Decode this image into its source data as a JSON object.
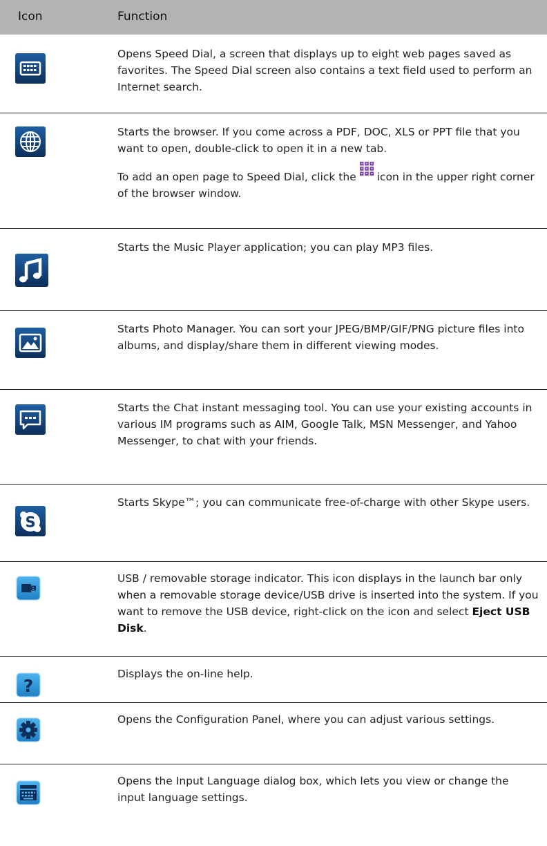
{
  "header": {
    "icon_label": "Icon",
    "function_label": "Function"
  },
  "rows": [
    {
      "icon": "speed-dial-icon",
      "text": "Opens Speed Dial, a screen that displays up to eight web pages saved as favorites. The Speed Dial screen also contains a text field used to perform an Internet search."
    },
    {
      "icon": "browser-globe-icon",
      "text": "Starts the browser. If you come across a PDF, DOC, XLS or PPT file that you want to open, double-click to open it in a new tab.",
      "text2_before": "To add an open page to Speed Dial, click the",
      "text2_after": "icon in the upper right corner of the browser window."
    },
    {
      "icon": "music-note-icon",
      "text": "Starts the Music Player application; you can play MP3 files."
    },
    {
      "icon": "photo-icon",
      "text": "Starts Photo Manager. You can sort your JPEG/BMP/GIF/PNG picture files into albums, and display/share them in different viewing modes."
    },
    {
      "icon": "chat-bubble-icon",
      "text": "Starts the Chat instant messaging tool. You can use your existing accounts in various IM programs such as AIM, Google Talk, MSN Messenger, and Yahoo Messenger, to chat with your friends."
    },
    {
      "icon": "skype-icon",
      "text": "Starts Skype™; you can communicate free-of-charge with other Skype users."
    },
    {
      "icon": "usb-storage-icon",
      "text": "USB / removable storage indicator. This icon displays in the launch bar only when a removable storage device/USB drive is inserted into the system. If you want to remove the USB device, right-click on the icon and select",
      "bold": "Eject USB Disk",
      "text_end": "."
    },
    {
      "icon": "help-icon",
      "text": "Displays the on-line help."
    },
    {
      "icon": "settings-gear-icon",
      "text": "Opens the Configuration Panel, where you can adjust various settings."
    },
    {
      "icon": "keyboard-icon",
      "text": "Opens the Input Language dialog box, which lets you view or change the input language settings."
    }
  ],
  "colors": {
    "header_bg": "#b3b3b3",
    "icon_dark": "#123a6b",
    "icon_light": "#2a8fd6",
    "speed_dial_purple": "#7b3fb0"
  }
}
